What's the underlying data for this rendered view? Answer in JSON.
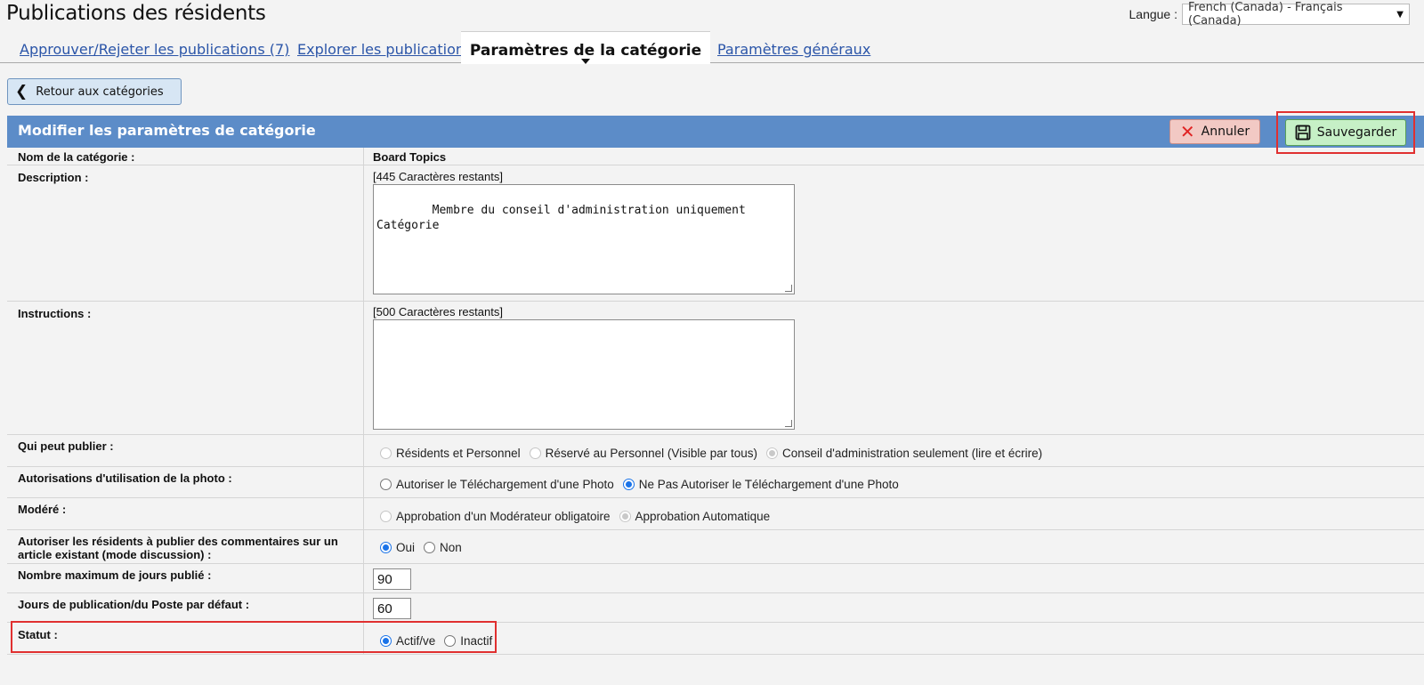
{
  "header": {
    "title": "Publications des résidents",
    "language_label": "Langue :",
    "language_value": "French (Canada) - Français (Canada)"
  },
  "tabs": [
    {
      "label": "Approuver/Rejeter les publications (7)"
    },
    {
      "label": "Explorer les publications"
    },
    {
      "label": "Paramètres de la catégorie",
      "active": true
    },
    {
      "label": "Paramètres généraux"
    }
  ],
  "back_button": {
    "label": "Retour aux catégories",
    "icon": "chevron-left-icon"
  },
  "panel": {
    "title": "Modifier les paramètres de catégorie",
    "cancel_label": "Annuler",
    "save_label": "Sauvegarder"
  },
  "fields": {
    "name": {
      "label": "Nom de la catégorie :",
      "value": "Board Topics"
    },
    "description": {
      "label": "Description :",
      "remaining": "[445 Caractères restants]",
      "value": "Membre du conseil d'administration uniquement\nCatégorie"
    },
    "instructions": {
      "label": "Instructions :",
      "remaining": "[500 Caractères restants]",
      "value": ""
    },
    "who_can_post": {
      "label": "Qui peut publier :",
      "options": [
        "Résidents et Personnel",
        "Réservé au Personnel (Visible par tous)",
        "Conseil d'administration seulement (lire et écrire)"
      ],
      "selected": 2
    },
    "photo_permissions": {
      "label": "Autorisations d'utilisation de la photo :",
      "options": [
        "Autoriser le Téléchargement d'une Photo",
        "Ne Pas Autoriser le Téléchargement d'une Photo"
      ],
      "selected": 1
    },
    "moderated": {
      "label": "Modéré :",
      "options": [
        "Approbation d'un Modérateur obligatoire",
        "Approbation Automatique"
      ],
      "selected": 1
    },
    "comments": {
      "label": "Autoriser les résidents à publier des commentaires sur un article existant (mode discussion) :",
      "options": [
        "Oui",
        "Non"
      ],
      "selected": 0
    },
    "max_days": {
      "label": "Nombre maximum de jours publié :",
      "value": "90"
    },
    "default_days": {
      "label": "Jours de publication/du Poste par défaut :",
      "value": "60"
    },
    "status": {
      "label": "Statut :",
      "options": [
        "Actif/ve",
        "Inactif"
      ],
      "selected": 0
    }
  },
  "colors": {
    "panel_header": "#5c8cc8",
    "link": "#2b55a8",
    "cancel_bg": "#f2c9c4",
    "save_bg": "#c6f0c6",
    "highlight": "#e03030"
  }
}
